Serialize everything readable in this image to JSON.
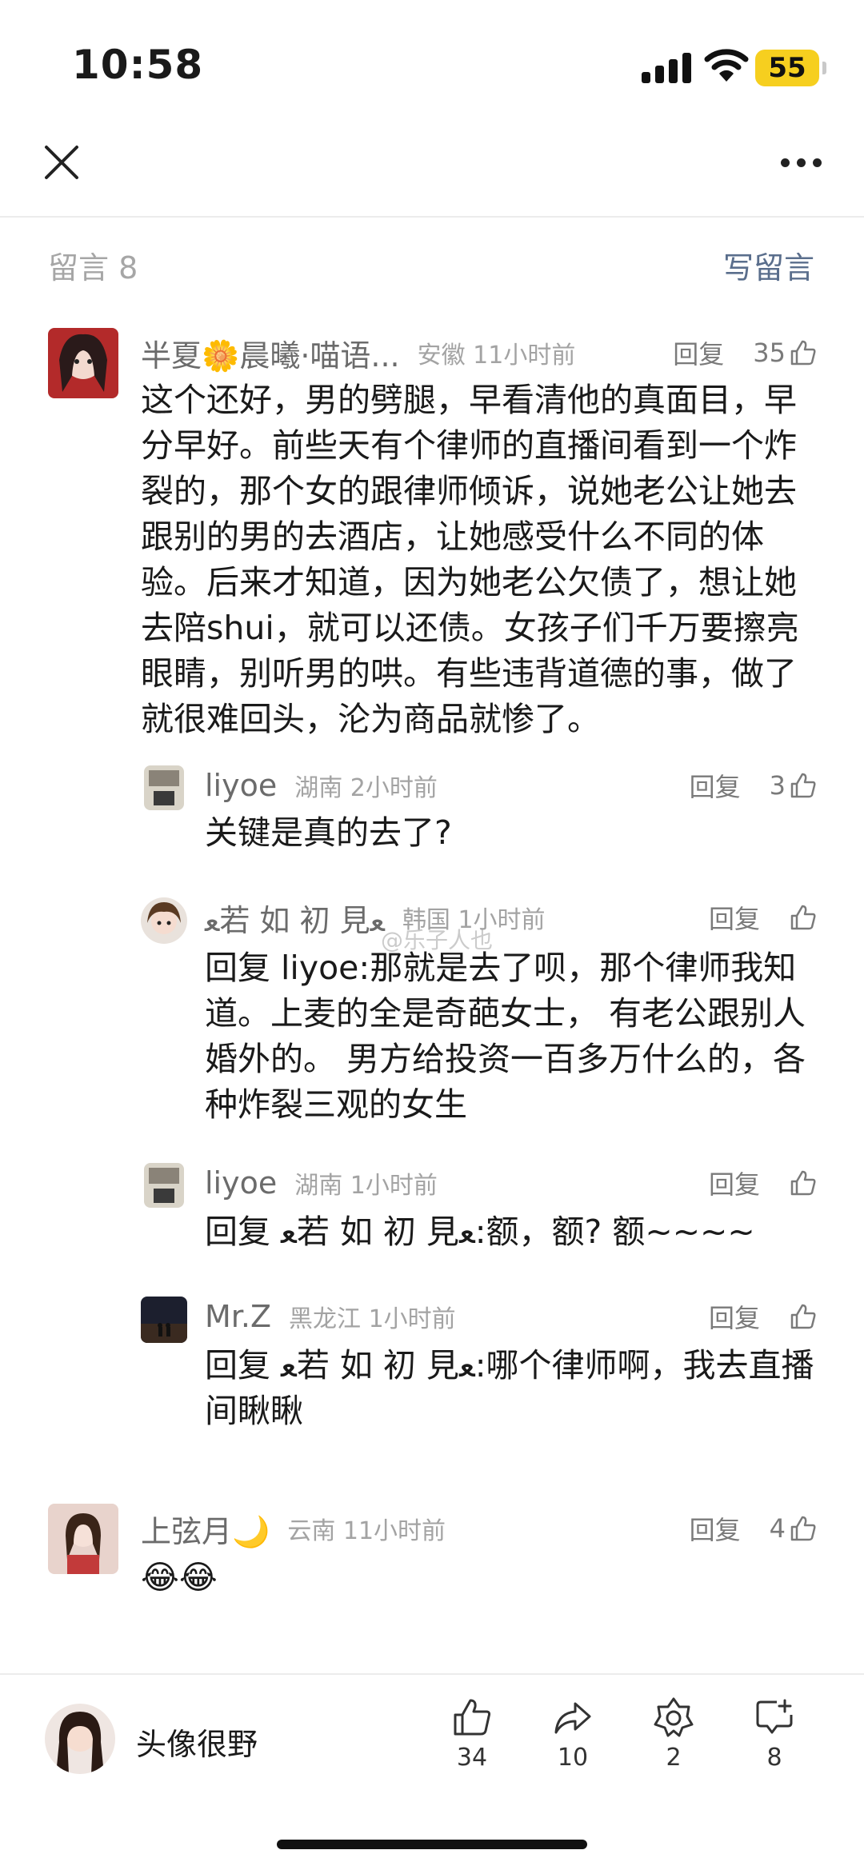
{
  "status_bar": {
    "time": "10:58",
    "battery": "55"
  },
  "header": {
    "comments_label": "留言 8",
    "write_comment_label": "写留言"
  },
  "comments": [
    {
      "nick": "半夏🌼晨曦·喵语...",
      "location_time": "安徽 11小时前",
      "reply_label": "回复",
      "likes": "35",
      "text": "这个还好，男的劈腿，早看清他的真面目，早分早好。前些天有个律师的直播间看到一个炸裂的，那个女的跟律师倾诉，说她老公让她去跟别的男的去酒店，让她感受什么不同的体验。后来才知道，因为她老公欠债了，想让她去陪shui，就可以还债。女孩子们千万要擦亮眼睛，别听男的哄。有些违背道德的事，做了就很难回头，沦为商品就惨了。"
    },
    {
      "nick": "liyoe",
      "location_time": "湖南 2小时前",
      "reply_label": "回复",
      "likes": "3",
      "text": "关键是真的去了?"
    },
    {
      "nick": "ﻌ若 如 初 見ﻌ",
      "location_time": "韩国 1小时前",
      "reply_label": "回复",
      "likes": "",
      "reply_to": "回复 liyoe:",
      "text": "那就是去了呗，那个律师我知道。上麦的全是奇葩女士， 有老公跟别人婚外的。 男方给投资一百多万什么的，各种炸裂三观的女生"
    },
    {
      "nick": "liyoe",
      "location_time": "湖南 1小时前",
      "reply_label": "回复",
      "likes": "",
      "reply_to": "回复 ﻌ若 如 初 見ﻌ:",
      "text": "额，额? 额~~~~"
    },
    {
      "nick": "Mr.Z",
      "location_time": "黑龙江 1小时前",
      "reply_label": "回复",
      "likes": "",
      "reply_to": "回复 ﻌ若 如 初 見ﻌ:",
      "text": "哪个律师啊，我去直播间瞅瞅"
    },
    {
      "nick": "上弦月🌙",
      "location_time": "云南 11小时前",
      "reply_label": "回复",
      "likes": "4",
      "text": "😂😂"
    }
  ],
  "watermark": "@乐子人也",
  "bottom_bar": {
    "user_name": "头像很野",
    "like_count": "34",
    "share_count": "10",
    "favorite_count": "2",
    "comment_count": "8"
  },
  "colors": {
    "accent_link": "#5a6e8c",
    "battery": "#f6cf1f"
  },
  "icons": [
    "close-icon",
    "more-icon",
    "thumb-up-icon",
    "share-icon",
    "favorite-icon",
    "comment-add-icon"
  ]
}
